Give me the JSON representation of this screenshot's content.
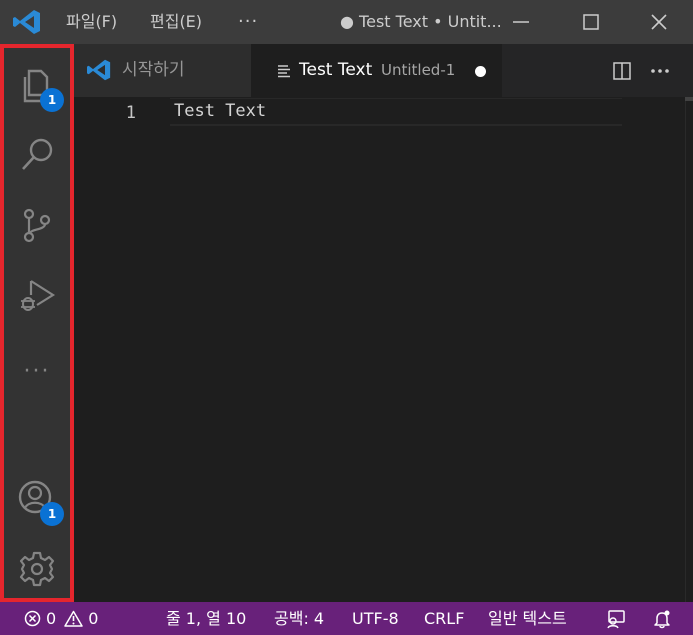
{
  "titlebar": {
    "menu_file": "파일(F)",
    "menu_edit": "편집(E)",
    "menu_more": "···",
    "window_title": "● Test Text • Untit..."
  },
  "activity_bar": {
    "explorer_badge": "1",
    "accounts_badge": "1",
    "more": "···",
    "border_color": "#e5262d",
    "badge_color": "#0a72d4"
  },
  "tabs": [
    {
      "label": "시작하기"
    },
    {
      "label": "Test Text",
      "description": "Untitled-1",
      "dirty": true
    }
  ],
  "editor": {
    "line_numbers": [
      "1"
    ],
    "lines": [
      "Test Text"
    ]
  },
  "statusbar": {
    "errors": "0",
    "warnings": "0",
    "position": "줄 1, 열 10",
    "indent": "공백: 4",
    "encoding": "UTF-8",
    "eol": "CRLF",
    "language": "일반 텍스트",
    "bg_color": "#68217a"
  }
}
